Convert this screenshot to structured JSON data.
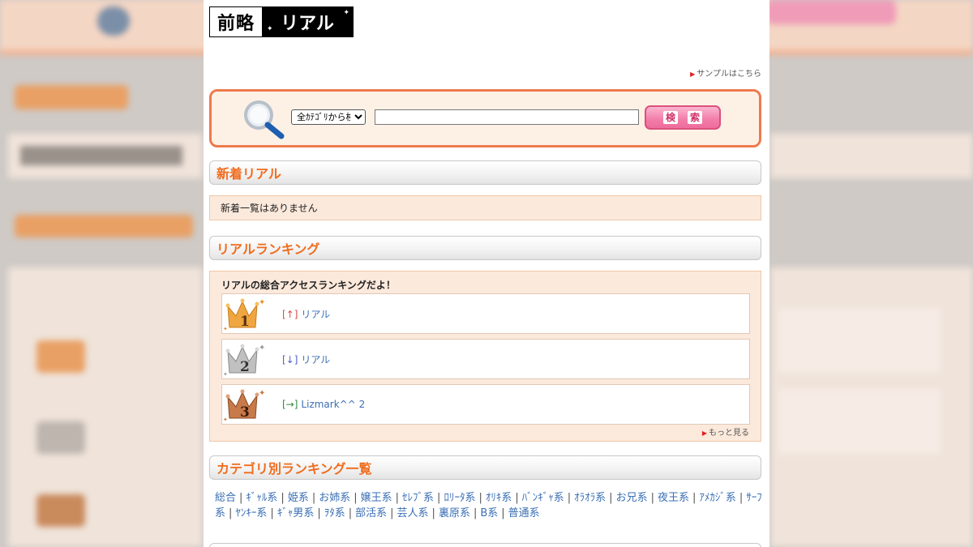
{
  "colors": {
    "accent_orange": "#f06c1e",
    "search_border": "#ee7a4e",
    "search_button": "#f27ca8",
    "link_blue": "#3a6fb4",
    "panel_bg": "#fbe9dc"
  },
  "logo": {
    "left_text": "前略",
    "right_text": "リアル"
  },
  "header": {
    "sample_link": "サンプルはこちら"
  },
  "search": {
    "category_selected": "全ｶﾃｺﾞﾘから検索",
    "input_value": "",
    "button_chars": [
      "検",
      "索"
    ],
    "icon": "magnifier-icon"
  },
  "new_section": {
    "title": "新着リアル",
    "empty_message": "新着一覧はありません"
  },
  "ranking_section": {
    "title": "リアルランキング",
    "intro": "リアルの総合アクセスランキングだよ！",
    "entries": [
      {
        "rank": "1",
        "arrow": "[↑]",
        "arrow_color": "#e04848",
        "name": "リアル",
        "crown_color": "#f0a640"
      },
      {
        "rank": "2",
        "arrow": "[↓]",
        "arrow_color": "#4a5fd0",
        "name": "リアル",
        "crown_color": "#b8b8b8"
      },
      {
        "rank": "3",
        "arrow": "[→]",
        "arrow_color": "#2f8a3a",
        "name": "Lizmark^^ 2",
        "crown_color": "#c77a4a"
      }
    ],
    "more_link": "もっと見る"
  },
  "category_section": {
    "title": "カテゴリ別ランキング一覧",
    "links": [
      "総合",
      "ｷﾞｬﾙ系",
      "姫系",
      "お姉系",
      "嬢王系",
      "ｾﾚﾌﾞ系",
      "ﾛﾘｰﾀ系",
      "ｵﾘｷ系",
      "ﾊﾞﾝｷﾞｬ系",
      "ｵﾗｵﾗ系",
      "お兄系",
      "夜王系",
      "ｱﾒｶｼﾞ系",
      "ｻｰﾌ系",
      "ﾔﾝｷｰ系",
      "ｷﾞｬ男系",
      "ｦﾀ系",
      "部活系",
      "芸人系",
      "裏原系",
      "B系",
      "普通系"
    ]
  }
}
